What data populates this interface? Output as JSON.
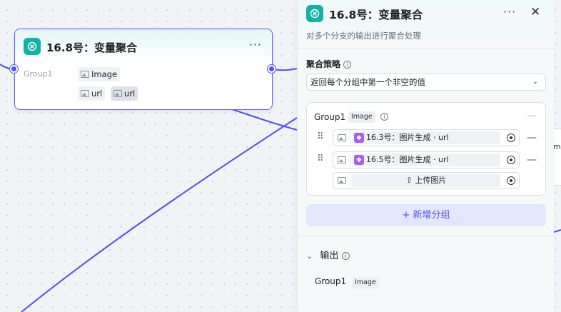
{
  "node": {
    "title": "16.8号：变量聚合",
    "more": "···",
    "group_label": "Group1",
    "tags": [
      "Image",
      "url",
      "url"
    ]
  },
  "side_node": {
    "text": "mp"
  },
  "panel": {
    "title": "16.8号：变量聚合",
    "more": "···",
    "close": "✕",
    "description": "对多个分支的输出进行聚合处理",
    "strategy_label": "聚合策略",
    "strategy_value": "返回每个分组中第一个非空的值",
    "group": {
      "name": "Group1",
      "type": "Image",
      "items": [
        {
          "label": "16.3号：图片生成 · url"
        },
        {
          "label": "16.5号：图片生成 · url"
        }
      ],
      "upload_label": "上传图片"
    },
    "add_group_label": "新增分组",
    "output": {
      "title": "输出",
      "group_name": "Group1",
      "group_type": "Image"
    }
  },
  "colors": {
    "accent": "#4d53e8",
    "node_icon": "#14b1a6",
    "plugin_icon": "#a85cf0"
  }
}
